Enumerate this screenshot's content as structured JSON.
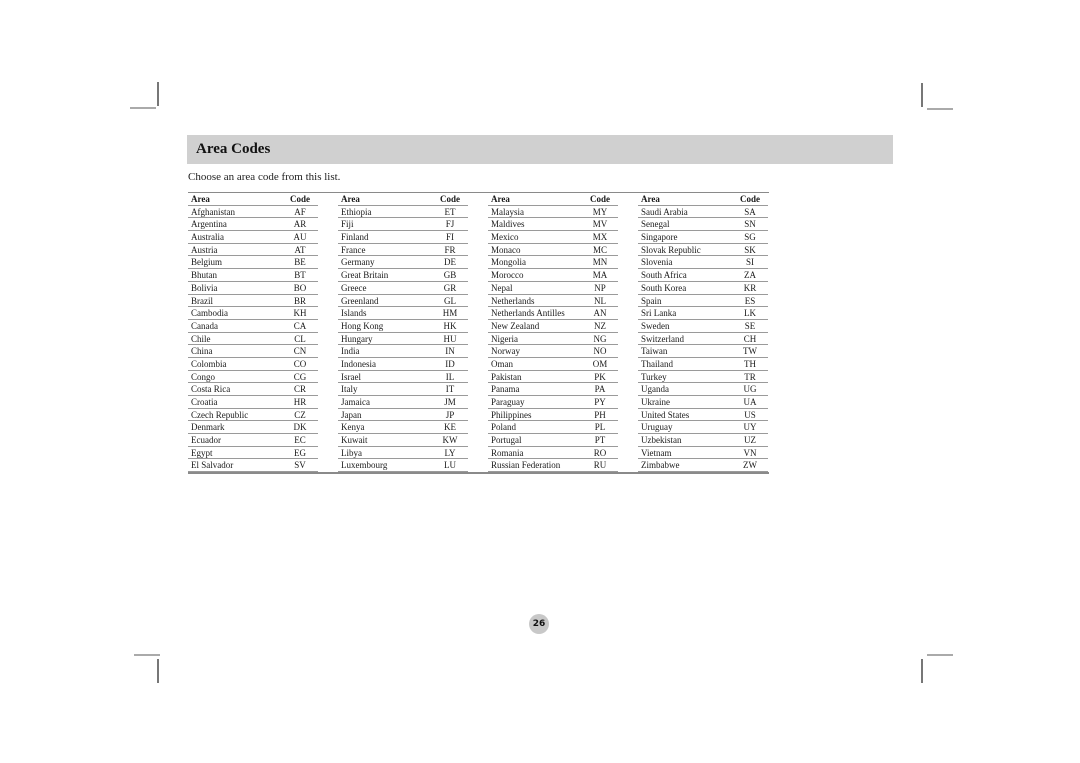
{
  "section": {
    "title": "Area Codes",
    "intro": "Choose an area code from this list."
  },
  "table": {
    "header": {
      "area": "Area",
      "code": "Code"
    },
    "columns": [
      [
        {
          "area": "Afghanistan",
          "code": "AF"
        },
        {
          "area": "Argentina",
          "code": "AR"
        },
        {
          "area": "Australia",
          "code": "AU"
        },
        {
          "area": "Austria",
          "code": "AT"
        },
        {
          "area": "Belgium",
          "code": "BE"
        },
        {
          "area": "Bhutan",
          "code": "BT"
        },
        {
          "area": "Bolivia",
          "code": "BO"
        },
        {
          "area": "Brazil",
          "code": "BR"
        },
        {
          "area": "Cambodia",
          "code": "KH"
        },
        {
          "area": "Canada",
          "code": "CA"
        },
        {
          "area": "Chile",
          "code": "CL"
        },
        {
          "area": "China",
          "code": "CN"
        },
        {
          "area": "Colombia",
          "code": "CO"
        },
        {
          "area": "Congo",
          "code": "CG"
        },
        {
          "area": "Costa Rica",
          "code": "CR"
        },
        {
          "area": "Croatia",
          "code": "HR"
        },
        {
          "area": "Czech Republic",
          "code": "CZ"
        },
        {
          "area": "Denmark",
          "code": "DK"
        },
        {
          "area": "Ecuador",
          "code": "EC"
        },
        {
          "area": "Egypt",
          "code": "EG"
        },
        {
          "area": "El Salvador",
          "code": "SV"
        }
      ],
      [
        {
          "area": "Ethiopia",
          "code": "ET"
        },
        {
          "area": "Fiji",
          "code": "FJ"
        },
        {
          "area": "Finland",
          "code": "FI"
        },
        {
          "area": "France",
          "code": "FR"
        },
        {
          "area": "Germany",
          "code": "DE"
        },
        {
          "area": "Great Britain",
          "code": "GB"
        },
        {
          "area": "Greece",
          "code": "GR"
        },
        {
          "area": "Greenland",
          "code": "GL"
        },
        {
          "area": "Islands",
          "code": "HM"
        },
        {
          "area": "Hong Kong",
          "code": "HK"
        },
        {
          "area": "Hungary",
          "code": "HU"
        },
        {
          "area": "India",
          "code": "IN"
        },
        {
          "area": "Indonesia",
          "code": "ID"
        },
        {
          "area": "Israel",
          "code": "IL"
        },
        {
          "area": "Italy",
          "code": "IT"
        },
        {
          "area": "Jamaica",
          "code": "JM"
        },
        {
          "area": "Japan",
          "code": "JP"
        },
        {
          "area": "Kenya",
          "code": "KE"
        },
        {
          "area": "Kuwait",
          "code": "KW"
        },
        {
          "area": "Libya",
          "code": "LY"
        },
        {
          "area": "Luxembourg",
          "code": "LU"
        }
      ],
      [
        {
          "area": "Malaysia",
          "code": "MY"
        },
        {
          "area": "Maldives",
          "code": "MV"
        },
        {
          "area": "Mexico",
          "code": "MX"
        },
        {
          "area": "Monaco",
          "code": "MC"
        },
        {
          "area": "Mongolia",
          "code": "MN"
        },
        {
          "area": "Morocco",
          "code": "MA"
        },
        {
          "area": "Nepal",
          "code": "NP"
        },
        {
          "area": "Netherlands",
          "code": "NL"
        },
        {
          "area": "Netherlands Antilles",
          "code": "AN"
        },
        {
          "area": "New Zealand",
          "code": "NZ"
        },
        {
          "area": "Nigeria",
          "code": "NG"
        },
        {
          "area": "Norway",
          "code": "NO"
        },
        {
          "area": "Oman",
          "code": "OM"
        },
        {
          "area": "Pakistan",
          "code": "PK"
        },
        {
          "area": "Panama",
          "code": "PA"
        },
        {
          "area": "Paraguay",
          "code": "PY"
        },
        {
          "area": "Philippines",
          "code": "PH"
        },
        {
          "area": "Poland",
          "code": "PL"
        },
        {
          "area": "Portugal",
          "code": "PT"
        },
        {
          "area": "Romania",
          "code": "RO"
        },
        {
          "area": "Russian Federation",
          "code": "RU"
        }
      ],
      [
        {
          "area": "Saudi Arabia",
          "code": "SA"
        },
        {
          "area": "Senegal",
          "code": "SN"
        },
        {
          "area": "Singapore",
          "code": "SG"
        },
        {
          "area": "Slovak Republic",
          "code": "SK"
        },
        {
          "area": "Slovenia",
          "code": "SI"
        },
        {
          "area": "South Africa",
          "code": "ZA"
        },
        {
          "area": "South Korea",
          "code": "KR"
        },
        {
          "area": "Spain",
          "code": "ES"
        },
        {
          "area": "Sri Lanka",
          "code": "LK"
        },
        {
          "area": "Sweden",
          "code": "SE"
        },
        {
          "area": "Switzerland",
          "code": "CH"
        },
        {
          "area": "Taiwan",
          "code": "TW"
        },
        {
          "area": "Thailand",
          "code": "TH"
        },
        {
          "area": "Turkey",
          "code": "TR"
        },
        {
          "area": "Uganda",
          "code": "UG"
        },
        {
          "area": "Ukraine",
          "code": "UA"
        },
        {
          "area": "United States",
          "code": "US"
        },
        {
          "area": "Uruguay",
          "code": "UY"
        },
        {
          "area": "Uzbekistan",
          "code": "UZ"
        },
        {
          "area": "Vietnam",
          "code": "VN"
        },
        {
          "area": "Zimbabwe",
          "code": "ZW"
        }
      ]
    ]
  },
  "footer": {
    "page_number": "26"
  }
}
